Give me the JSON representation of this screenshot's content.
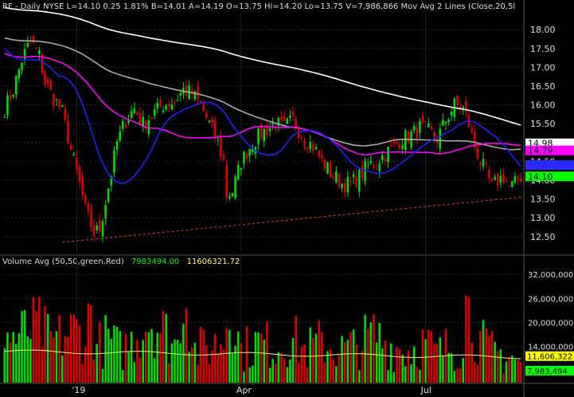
{
  "header": {
    "symbol": "RF",
    "period": "Daily",
    "exchange": "NYSE",
    "last": "L=14.10",
    "change": "0.25",
    "change_pct": "1.81%",
    "bid": "B=14.01",
    "ask": "A=14.19",
    "open": "O=13.75",
    "high": "Hi=14.20",
    "low": "Lo=13.75",
    "volume": "V=7,986,866",
    "study": "Mov Avg 2 Lines (Close,20,5l"
  },
  "volume_header": {
    "label": "Volume Avg (50,50,green,Red)",
    "green_value": "7983494.00",
    "red_value": "11606321.72"
  },
  "x_labels": [
    {
      "label": "'19",
      "index": 25
    },
    {
      "label": "Apr",
      "index": 82
    },
    {
      "label": "Jul",
      "index": 146
    }
  ],
  "price_axis": {
    "ticks": [
      "18.00",
      "17.50",
      "17.00",
      "16.50",
      "16.00",
      "15.50",
      "15.00",
      "14.50",
      "14.00",
      "13.50",
      "13.00",
      "12.50"
    ],
    "min": 12.05,
    "max": 18.45,
    "tags": [
      {
        "value": "14.98",
        "bg": "#ffffff",
        "fg": "#000000"
      },
      {
        "value": "14.79",
        "bg": "#ff00ff",
        "fg": "#000000"
      },
      {
        "value": "14.40",
        "bg": "#2a2aff",
        "fg": "#2a2aff"
      },
      {
        "value": "14.10",
        "bg": "#00ff00",
        "fg": "#000000"
      }
    ]
  },
  "volume_axis": {
    "ticks": [
      "32,000,000",
      "26,000,000",
      "20,000,000",
      "14,000,000"
    ],
    "min": 5000000,
    "max": 34000000,
    "tags": [
      {
        "value": "11,606,322",
        "bg": "#ffff00",
        "fg": "#000000"
      },
      {
        "value": "7,983,494",
        "bg": "#00ff00",
        "fg": "#000000"
      }
    ]
  },
  "colors": {
    "up": "#00e000",
    "down": "#e00000",
    "ma20": "#2020ff",
    "ma50": "#ff00ff",
    "ma100": "#aaaaaa",
    "ma200": "#ffffff",
    "trend": "#ff3030",
    "vol_avg": "#ffff66"
  },
  "chart_data": {
    "type": "candlestick",
    "bar_count": 180,
    "close_path": [
      [
        0,
        15.9
      ],
      [
        3,
        16.4
      ],
      [
        6,
        17.2
      ],
      [
        9,
        17.7
      ],
      [
        12,
        17.3
      ],
      [
        14,
        16.6
      ],
      [
        17,
        16.2
      ],
      [
        20,
        15.8
      ],
      [
        23,
        14.8
      ],
      [
        26,
        13.9
      ],
      [
        28,
        13.2
      ],
      [
        31,
        12.6
      ],
      [
        33,
        12.7
      ],
      [
        36,
        13.8
      ],
      [
        39,
        15.0
      ],
      [
        42,
        15.6
      ],
      [
        45,
        15.9
      ],
      [
        48,
        15.5
      ],
      [
        52,
        15.8
      ],
      [
        55,
        16.0
      ],
      [
        59,
        16.1
      ],
      [
        62,
        16.4
      ],
      [
        65,
        16.3
      ],
      [
        68,
        16.0
      ],
      [
        71,
        15.5
      ],
      [
        74,
        15.0
      ],
      [
        76,
        14.5
      ],
      [
        77,
        13.6
      ],
      [
        79,
        13.7
      ],
      [
        82,
        14.5
      ],
      [
        86,
        15.0
      ],
      [
        90,
        15.3
      ],
      [
        94,
        15.5
      ],
      [
        97,
        15.4
      ],
      [
        100,
        15.6
      ],
      [
        104,
        15.1
      ],
      [
        107,
        14.9
      ],
      [
        110,
        14.5
      ],
      [
        113,
        14.2
      ],
      [
        117,
        13.9
      ],
      [
        120,
        13.9
      ],
      [
        123,
        14.1
      ],
      [
        126,
        14.4
      ],
      [
        129,
        14.5
      ],
      [
        132,
        14.7
      ],
      [
        135,
        14.9
      ],
      [
        138,
        15.1
      ],
      [
        141,
        15.2
      ],
      [
        144,
        15.4
      ],
      [
        147,
        15.3
      ],
      [
        150,
        15.1
      ],
      [
        153,
        15.6
      ],
      [
        156,
        16.0
      ],
      [
        159,
        15.9
      ],
      [
        161,
        15.5
      ],
      [
        163,
        14.9
      ],
      [
        165,
        14.5
      ],
      [
        167,
        14.2
      ],
      [
        169,
        13.8
      ],
      [
        171,
        14.0
      ],
      [
        173,
        14.1
      ],
      [
        175,
        13.8
      ],
      [
        177,
        13.9
      ],
      [
        179,
        14.1
      ]
    ],
    "volume_path": [
      [
        0,
        17000000
      ],
      [
        4,
        16000000
      ],
      [
        8,
        18000000
      ],
      [
        12,
        19000000
      ],
      [
        16,
        15000000
      ],
      [
        20,
        16500000
      ],
      [
        24,
        18000000
      ],
      [
        28,
        17000000
      ],
      [
        30,
        23000000
      ],
      [
        32,
        14000000
      ],
      [
        36,
        16000000
      ],
      [
        40,
        13000000
      ],
      [
        44,
        15000000
      ],
      [
        50,
        21000000
      ],
      [
        55,
        18000000
      ],
      [
        60,
        14000000
      ],
      [
        62,
        30000000
      ],
      [
        66,
        13000000
      ],
      [
        72,
        14000000
      ],
      [
        76,
        16000000
      ],
      [
        78,
        25000000
      ],
      [
        82,
        13000000
      ],
      [
        88,
        15000000
      ],
      [
        94,
        14000000
      ],
      [
        100,
        16000000
      ],
      [
        104,
        13000000
      ],
      [
        110,
        15000000
      ],
      [
        116,
        13000000
      ],
      [
        122,
        14000000
      ],
      [
        128,
        17000000
      ],
      [
        134,
        14000000
      ],
      [
        140,
        13000000
      ],
      [
        146,
        15000000
      ],
      [
        150,
        12000000
      ],
      [
        154,
        14000000
      ],
      [
        158,
        13500000
      ],
      [
        160,
        25000000
      ],
      [
        164,
        16000000
      ],
      [
        168,
        13000000
      ],
      [
        172,
        12000000
      ],
      [
        176,
        11500000
      ],
      [
        179,
        9000000
      ]
    ],
    "trend_line": [
      [
        20,
        12.35
      ],
      [
        180,
        13.55
      ]
    ],
    "price_min": 12.05,
    "price_max": 18.45,
    "ma_periods": [
      20,
      50,
      100,
      200
    ],
    "volume_avg_level": 11606322
  }
}
